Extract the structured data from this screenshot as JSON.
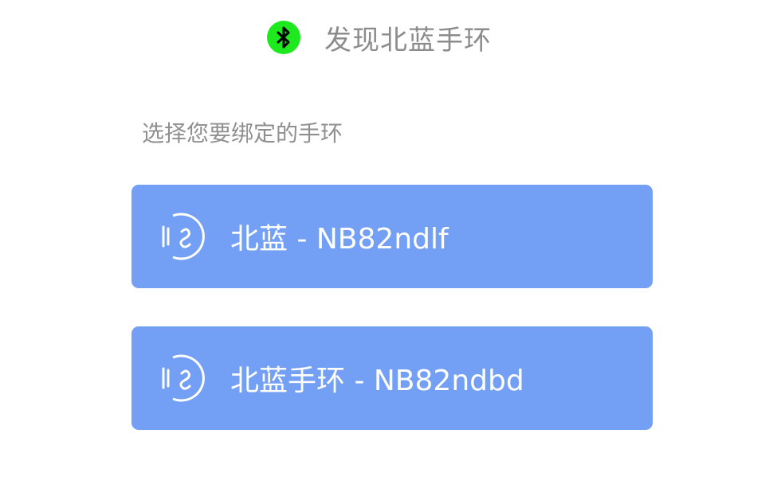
{
  "header": {
    "title": "发现北蓝手环",
    "icon": "bluetooth-icon",
    "icon_color": "#1ee81e"
  },
  "subtitle": "选择您要绑定的手环",
  "devices": [
    {
      "label": "北蓝 - NB82ndlf",
      "icon": "band-icon"
    },
    {
      "label": "北蓝手环 - NB82ndbd",
      "icon": "band-icon"
    }
  ],
  "colors": {
    "card_background": "#739ff4",
    "card_text": "#ffffff",
    "muted_text": "#8c8c8c"
  }
}
